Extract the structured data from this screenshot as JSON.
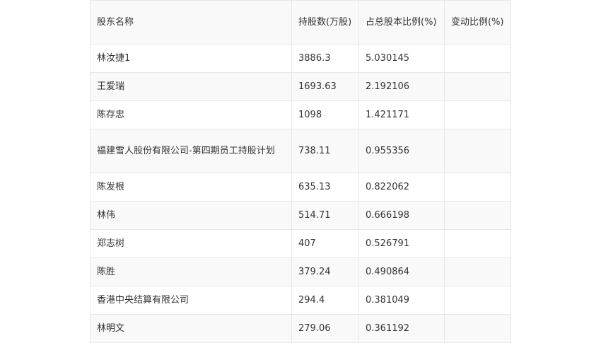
{
  "table": {
    "headers": [
      "股东名称",
      "持股数(万股)",
      "占总股本比例(%)",
      "变动比例(%)"
    ],
    "rows": [
      [
        "林汝捷1",
        "3886.3",
        "5.030145",
        ""
      ],
      [
        "王爱瑞",
        "1693.63",
        "2.192106",
        ""
      ],
      [
        "陈存忠",
        "1098",
        "1.421171",
        ""
      ],
      [
        "福建雪人股份有限公司-第四期员工持股计划",
        "738.11",
        "0.955356",
        ""
      ],
      [
        "陈发根",
        "635.13",
        "0.822062",
        ""
      ],
      [
        "林伟",
        "514.71",
        "0.666198",
        ""
      ],
      [
        "郑志树",
        "407",
        "0.526791",
        ""
      ],
      [
        "陈胜",
        "379.24",
        "0.490864",
        ""
      ],
      [
        "香港中央结算有限公司",
        "294.4",
        "0.381049",
        ""
      ],
      [
        "林明文",
        "279.06",
        "0.361192",
        ""
      ]
    ]
  }
}
